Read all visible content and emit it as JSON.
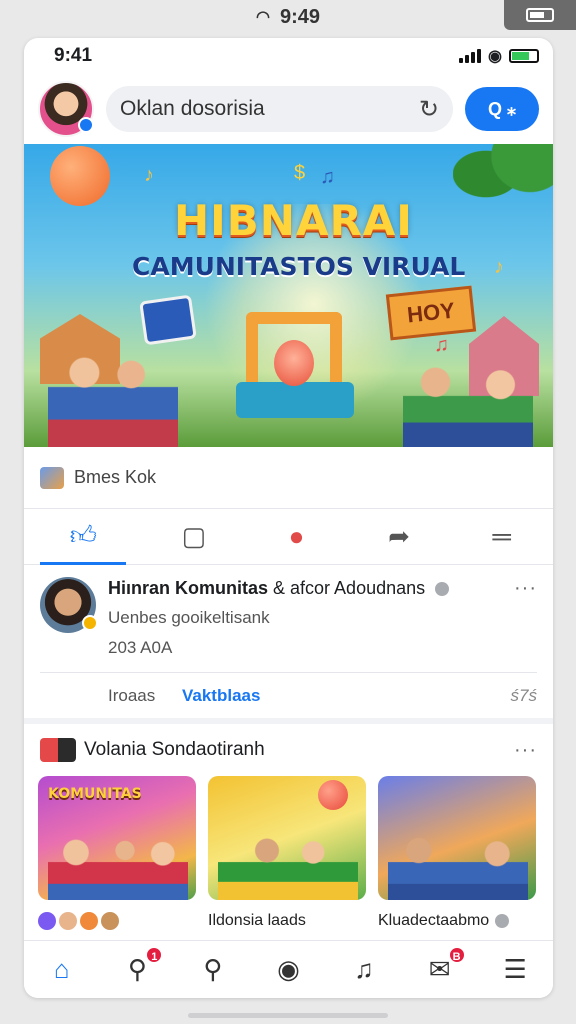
{
  "outer_status": {
    "time": "9:49"
  },
  "status": {
    "time": "9:41"
  },
  "header": {
    "search_text": "Oklan dosorisia",
    "search_button_label": "Q ⁎"
  },
  "banner": {
    "title_line1": "HIBNARAI",
    "title_line2": "CAMUNITASTOS VIRUAL",
    "sign_text": "HOY"
  },
  "page_name": "Bmes Kok",
  "post": {
    "title_bold": "Hiınran Komunitas",
    "title_rest": " & afcor Adoudnans",
    "subtitle": "Uenbes gooikeltisank",
    "date": "203 A0A",
    "footer_left": "Iroaas",
    "footer_link": "Vaktblaas",
    "footer_count": "ś7ś"
  },
  "section": {
    "title": "Volania Sondaotiranh",
    "more": "···"
  },
  "cards": [
    {
      "image_label": "KOMUNITAS",
      "caption": ""
    },
    {
      "image_label": "",
      "caption": "Ildonsia laads"
    },
    {
      "image_label": "",
      "caption": "Kluadectaabmo"
    }
  ],
  "nav": {
    "search_badge": "1",
    "messages_badge": "B"
  },
  "colors": {
    "accent": "#1877f2",
    "badge_red": "#e41e3f"
  }
}
